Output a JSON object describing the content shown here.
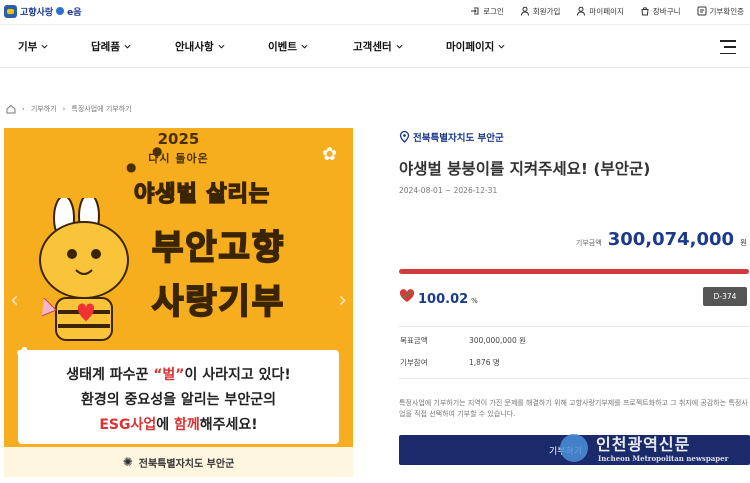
{
  "header": {
    "logo_text": "고향사랑",
    "logo_suffix": "e음",
    "utils": [
      {
        "label": "로그인",
        "icon": "login-icon"
      },
      {
        "label": "회원가입",
        "icon": "user-icon"
      },
      {
        "label": "마이페이지",
        "icon": "user-icon"
      },
      {
        "label": "장바구니",
        "icon": "cart-icon"
      },
      {
        "label": "기부확인증",
        "icon": "certificate-icon"
      }
    ]
  },
  "nav": {
    "items": [
      "기부",
      "답례품",
      "안내사항",
      "이벤트",
      "고객센터",
      "마이페이지"
    ]
  },
  "breadcrumb": [
    "기부하기",
    "특정사업에 기부하기"
  ],
  "banner": {
    "year": "2025",
    "subtitle": "다시 돌아온",
    "title_line1": "야생벌 살리는",
    "title_line2": "부안고향",
    "title_line3": "사랑기부",
    "body_line1_pre": "생태계 파수꾼 ",
    "body_line1_highlight": "“벌”",
    "body_line1_post": "이 사라지고 있다!",
    "body_line2": "환경의 중요성을 알리는 부안군의",
    "body_line3_highlight": "ESG사업",
    "body_line3_mid": "에 ",
    "body_line3_highlight2": "함께",
    "body_line3_post": "해주세요!",
    "footer": "전북특별자치도 부안군"
  },
  "project": {
    "region": "전북특별자치도 부안군",
    "title": "야생벌 붕붕이를 지켜주세요! (부안군)",
    "date_range": "2024-08-01 ~ 2026-12-31",
    "amount_label": "기부금액",
    "amount": "300,074,000",
    "amount_unit": "원",
    "progress_fraction": 1.0,
    "percent": "100.02",
    "percent_unit": "%",
    "dday": "D-374",
    "goal_label": "목표금액",
    "goal_value": "300,000,000 원",
    "participants_label": "기부참여",
    "participants_value": "1,876 명",
    "description": "특정사업에 기부하기는 지역이 가진 문제를 해결하기 위해 고향사랑기부제를 프로젝트화하고 그 취지에 공감하는 특정사업을 직접 선택하여 기부할 수 있습니다.",
    "donate_button": "기부하기"
  },
  "watermark": {
    "title": "인천광역신문",
    "subtitle": "Incheon Metropolitan newspaper"
  },
  "colors": {
    "brand": "#1b3a8c",
    "progress": "#d23b3b",
    "banner_bg": "#f6ad1e",
    "button": "#1b2a6b"
  }
}
